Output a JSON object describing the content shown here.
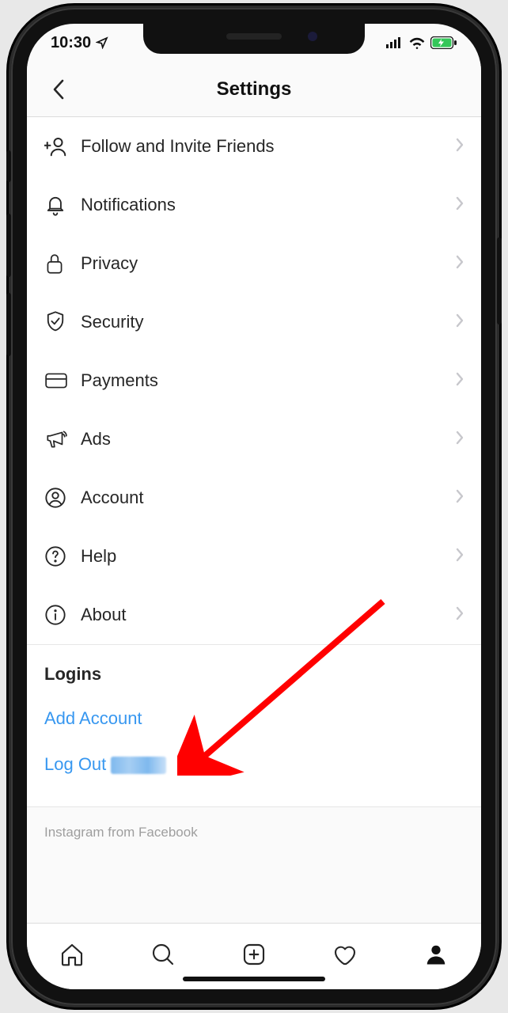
{
  "status": {
    "time": "10:30"
  },
  "header": {
    "title": "Settings"
  },
  "settings": {
    "items": [
      {
        "icon": "add-friend-icon",
        "label": "Follow and Invite Friends"
      },
      {
        "icon": "bell-icon",
        "label": "Notifications"
      },
      {
        "icon": "lock-icon",
        "label": "Privacy"
      },
      {
        "icon": "shield-icon",
        "label": "Security"
      },
      {
        "icon": "card-icon",
        "label": "Payments"
      },
      {
        "icon": "megaphone-icon",
        "label": "Ads"
      },
      {
        "icon": "account-icon",
        "label": "Account"
      },
      {
        "icon": "help-icon",
        "label": "Help"
      },
      {
        "icon": "info-icon",
        "label": "About"
      }
    ]
  },
  "logins": {
    "title": "Logins",
    "add_account": "Add Account",
    "log_out": "Log Out"
  },
  "footer": {
    "note": "Instagram from Facebook"
  },
  "annotation": {
    "points_to": "add-account-link",
    "color": "#ff0000"
  }
}
